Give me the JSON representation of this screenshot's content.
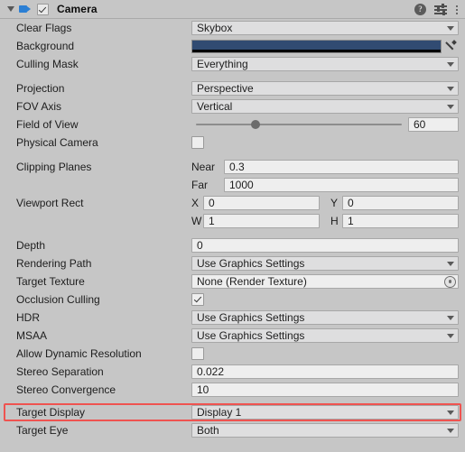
{
  "header": {
    "title": "Camera",
    "enabled": true,
    "foldout_icon": "triangle-down-icon",
    "component_icon": "camera-icon",
    "tools": [
      {
        "name": "help-icon",
        "glyph": "?"
      },
      {
        "name": "preset-icon",
        "glyph": ""
      },
      {
        "name": "more-menu-icon",
        "glyph": ""
      }
    ]
  },
  "colors": {
    "panel_bg": "#c6c6c6",
    "field_bg": "#eeeeee",
    "dropdown_bg": "#dededf",
    "border": "#a7a7a7",
    "accent_icon": "#2b7fd4",
    "highlight": "#ef5350",
    "background_color_swatch": "#314b72"
  },
  "properties": {
    "clear_flags": {
      "label": "Clear Flags",
      "value": "Skybox"
    },
    "background": {
      "label": "Background",
      "value": "#314b72",
      "alpha_bar": "#000000"
    },
    "culling_mask": {
      "label": "Culling Mask",
      "value": "Everything"
    },
    "projection": {
      "label": "Projection",
      "value": "Perspective"
    },
    "fov_axis": {
      "label": "FOV Axis",
      "value": "Vertical"
    },
    "field_of_view": {
      "label": "Field of View",
      "value": "60",
      "slider_percent": 30
    },
    "physical_camera": {
      "label": "Physical Camera",
      "checked": false
    },
    "clipping_planes": {
      "label": "Clipping Planes",
      "near_label": "Near",
      "near_value": "0.3",
      "far_label": "Far",
      "far_value": "1000"
    },
    "viewport_rect": {
      "label": "Viewport Rect",
      "x_label": "X",
      "x_value": "0",
      "y_label": "Y",
      "y_value": "0",
      "w_label": "W",
      "w_value": "1",
      "h_label": "H",
      "h_value": "1"
    },
    "depth": {
      "label": "Depth",
      "value": "0"
    },
    "rendering_path": {
      "label": "Rendering Path",
      "value": "Use Graphics Settings"
    },
    "target_texture": {
      "label": "Target Texture",
      "value": "None (Render Texture)"
    },
    "occlusion_culling": {
      "label": "Occlusion Culling",
      "checked": true
    },
    "hdr": {
      "label": "HDR",
      "value": "Use Graphics Settings"
    },
    "msaa": {
      "label": "MSAA",
      "value": "Use Graphics Settings"
    },
    "allow_dynamic_resolution": {
      "label": "Allow Dynamic Resolution",
      "checked": false
    },
    "stereo_separation": {
      "label": "Stereo Separation",
      "value": "0.022"
    },
    "stereo_convergence": {
      "label": "Stereo Convergence",
      "value": "10"
    },
    "target_display": {
      "label": "Target Display",
      "value": "Display 1",
      "highlighted": true
    },
    "target_eye": {
      "label": "Target Eye",
      "value": "Both"
    }
  }
}
